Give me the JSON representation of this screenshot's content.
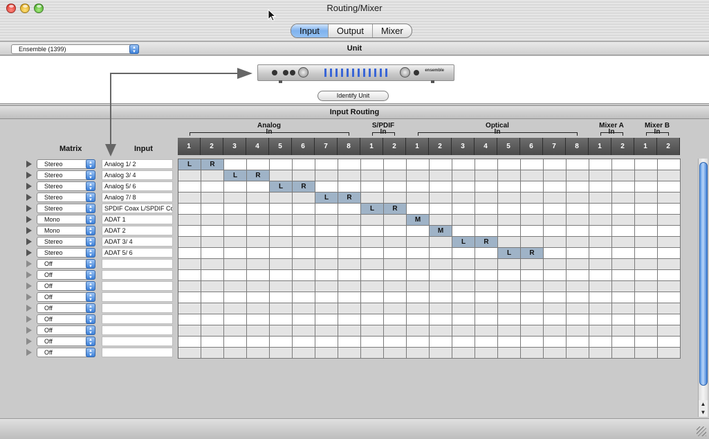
{
  "window": {
    "title": "Routing/Mixer"
  },
  "tabs": [
    {
      "label": "Input",
      "active": true
    },
    {
      "label": "Output",
      "active": false
    },
    {
      "label": "Mixer",
      "active": false
    }
  ],
  "unit": {
    "selected": "Ensemble (1399)",
    "section_label": "Unit",
    "identify_label": "Identify Unit",
    "device_brand": "ensemble"
  },
  "routing": {
    "section_label": "Input Routing",
    "matrix_header": "Matrix",
    "input_header": "Input",
    "groups": [
      {
        "name": "Analog",
        "sub": "In",
        "cols": [
          1,
          2,
          3,
          4,
          5,
          6,
          7,
          8
        ]
      },
      {
        "name": "S/PDIF",
        "sub": "In",
        "cols": [
          1,
          2
        ]
      },
      {
        "name": "Optical",
        "sub": "In",
        "cols": [
          1,
          2,
          3,
          4,
          5,
          6,
          7,
          8
        ]
      },
      {
        "name": "Mixer A",
        "sub": "In",
        "cols": [
          1,
          2
        ]
      },
      {
        "name": "Mixer B",
        "sub": "In",
        "cols": [
          1,
          2
        ]
      }
    ],
    "rows": [
      {
        "mode": "Stereo",
        "input": "Analog 1/ 2",
        "cells": [
          [
            0,
            "L"
          ],
          [
            1,
            "R"
          ]
        ]
      },
      {
        "mode": "Stereo",
        "input": "Analog 3/ 4",
        "cells": [
          [
            2,
            "L"
          ],
          [
            3,
            "R"
          ]
        ]
      },
      {
        "mode": "Stereo",
        "input": "Analog 5/ 6",
        "cells": [
          [
            4,
            "L"
          ],
          [
            5,
            "R"
          ]
        ]
      },
      {
        "mode": "Stereo",
        "input": "Analog 7/ 8",
        "cells": [
          [
            6,
            "L"
          ],
          [
            7,
            "R"
          ]
        ]
      },
      {
        "mode": "Stereo",
        "input": "SPDIF Coax L/SPDIF Co",
        "cells": [
          [
            8,
            "L"
          ],
          [
            9,
            "R"
          ]
        ]
      },
      {
        "mode": "Mono",
        "input": "ADAT 1",
        "cells": [
          [
            10,
            "M"
          ]
        ]
      },
      {
        "mode": "Mono",
        "input": "ADAT 2",
        "cells": [
          [
            11,
            "M"
          ]
        ]
      },
      {
        "mode": "Stereo",
        "input": "ADAT 3/ 4",
        "cells": [
          [
            12,
            "L"
          ],
          [
            13,
            "R"
          ]
        ]
      },
      {
        "mode": "Stereo",
        "input": "ADAT 5/ 6",
        "cells": [
          [
            14,
            "L"
          ],
          [
            15,
            "R"
          ]
        ]
      },
      {
        "mode": "Off",
        "input": "",
        "cells": []
      },
      {
        "mode": "Off",
        "input": "",
        "cells": []
      },
      {
        "mode": "Off",
        "input": "",
        "cells": []
      },
      {
        "mode": "Off",
        "input": "",
        "cells": []
      },
      {
        "mode": "Off",
        "input": "",
        "cells": []
      },
      {
        "mode": "Off",
        "input": "",
        "cells": []
      },
      {
        "mode": "Off",
        "input": "",
        "cells": []
      },
      {
        "mode": "Off",
        "input": "",
        "cells": []
      },
      {
        "mode": "Off",
        "input": "",
        "cells": []
      }
    ]
  },
  "colors": {
    "active_cell": "#9fb3c7",
    "tab_active": "#7fb2ee"
  }
}
